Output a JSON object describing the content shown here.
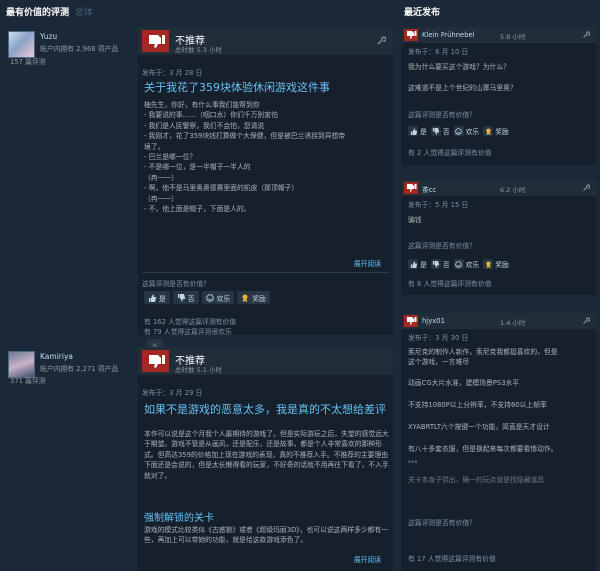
{
  "headers": {
    "most_helpful": "最有价值的评测",
    "overall": "总体",
    "recent": "最近发布"
  },
  "reviews": [
    {
      "author": "Yuzu",
      "owned": "帐户内拥有 2,968 项产品",
      "review_count": "157 篇评测",
      "verdict": "不推荐",
      "hours": "总时数 5.3 小时",
      "posted": "发布于：3 月 28 日",
      "title": "关于我花了359块体验休闲游戏这件事",
      "lines": [
        "柚先生，你好，有什么事我们能帮到你",
        "- 我要说的事……（咽口水）你们千万别害怕",
        "- 我们是人民警察，我们不会怕，您请说",
        "- 我刚才，花了359块钱打算做个大保健，但是被巴兰诱拐到异想帝",
        "   境了。",
        "- 巴兰是哪一位？",
        "- 不是哪一位，是一半帽子一半人的",
        "   （冉一一）",
        "- 啊，他不是马里奥奥德赛里面的凯皮（那顶帽子）",
        "   （冉一一）",
        "- 不，他上面是帽子，下面是人的。"
      ],
      "expand": "展开阅读",
      "helpful_question": "这篇评测是否有价值？",
      "buttons": [
        "是",
        "否",
        "欢乐",
        "奖励"
      ],
      "stat_helpful": "有 162 人觉得这篇评测有价值",
      "stat_funny": "有 79 人觉得这篇评测很欢乐"
    },
    {
      "author": "Kamiriya",
      "owned": "帐户内拥有 2,271 项产品",
      "review_count": "371 篇评测",
      "verdict": "不推荐",
      "hours": "总时数 5.1 小时",
      "posted": "发布于：3 月 29 日",
      "title": "如果不是游戏的恶意太多，我是真的不太想给差评",
      "body": "本作可以说是这个月我个人最期待的游戏了。但是实际游玩之后，失望的感觉远大于期望。游戏不管是从画风，还是配乐，还是故事，都是个人非常喜欢的那种形式。但高达359的价格加上现在游戏的表现，真的不推荐入手。不推荐的主要理由下面还是会说的，但是太长懒得看的玩家，不好奇的话就不用再往下看了，不入手就对了。",
      "subtitle": "强制解锁的关卡",
      "body2": "游戏的模式比较类似《古惑狼》或者《超级玛丽3D》，也可以说这两样多少都有一些，再加上可以带她的功能，就是给这款游戏添色了。",
      "expand": "展开阅读"
    }
  ],
  "recent": [
    {
      "author": "Klein Frühnebel",
      "hours": "5.8 小时",
      "posted": "发布于：6 月 10 日",
      "lines": [
        "我为什么要买这个游戏？为什么？",
        "这难道不是上个世纪的山寨马里奥？"
      ],
      "helpful_question": "这篇评测是否有价值？",
      "buttons": [
        "是",
        "否",
        "欢乐",
        "奖励"
      ],
      "stat": "有 2 人觉得这篇评测有价值"
    },
    {
      "author": "茶cc",
      "hours": "6.2 小时",
      "posted": "发布于：5 月 15 日",
      "lines": [
        "骗钱"
      ],
      "helpful_question": "这篇评测是否有价值？",
      "buttons": [
        "是",
        "否",
        "欢乐",
        "奖励"
      ],
      "stat": "有 6 人觉得这篇评测有价值"
    },
    {
      "author": "hjyx01",
      "hours": "1.4 小时",
      "posted": "发布于：3 月 30 日",
      "lines": [
        "索尼克的制作人新作，索尼克我都挺喜欢的，但是",
        "这个游戏，一言难尽",
        "动画CG大片水准，建模场景PS3水平",
        "不支持1080P以上分辨率，不支持60以上帧率",
        "XYABRTLT六个按键一个功能，简直是天才设计",
        "有八十多套衣服，但是换起来每次都要看惨动作。",
        "。。。",
        "关卡本身子供出，确一的玩点就是找隐藏道具"
      ],
      "helpful_question": "这篇评测是否有价值？",
      "stat": "有 17 人觉得这篇评测有价值"
    }
  ],
  "colors": {
    "bg": "#1b2838",
    "thumb_red": "#a32722",
    "link_blue": "#66c0f4"
  }
}
